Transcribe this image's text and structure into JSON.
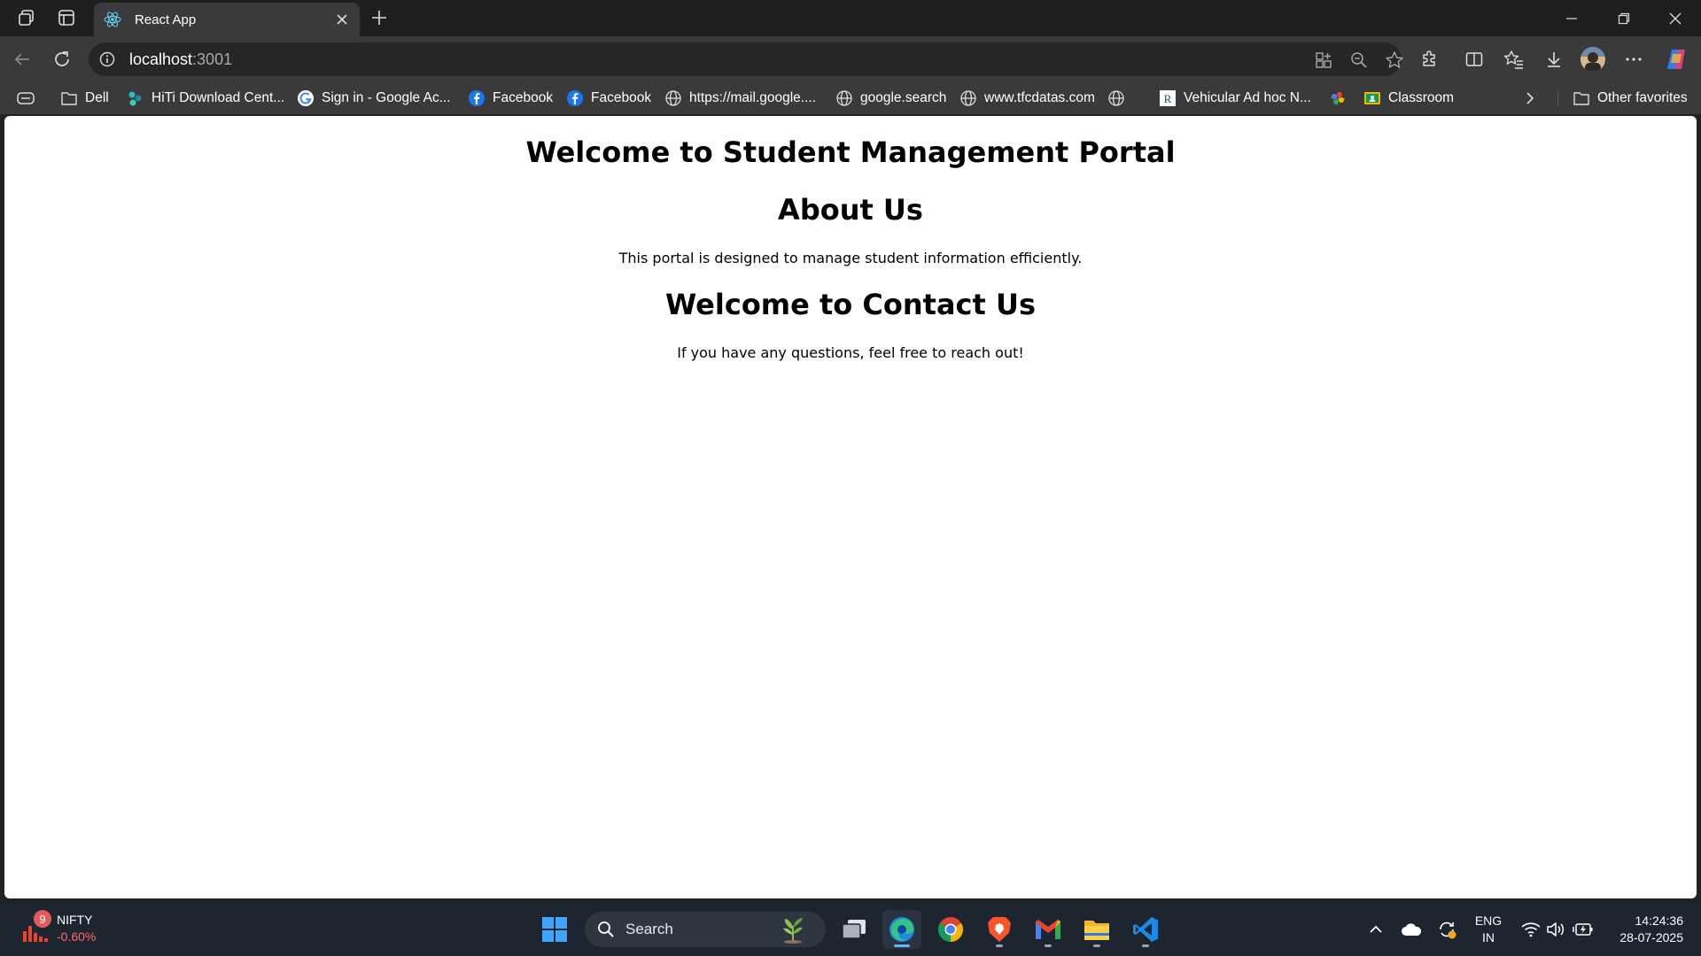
{
  "tab": {
    "title": "React App"
  },
  "omnibox": {
    "host": "localhost",
    "port": ":3001"
  },
  "bookmarks": {
    "items": [
      {
        "label": "Dell",
        "icon": "folder-icon"
      },
      {
        "label": "HiTi Download Cent...",
        "icon": "hiti-icon"
      },
      {
        "label": "Sign in - Google Ac...",
        "icon": "google-icon"
      },
      {
        "label": "Facebook",
        "icon": "facebook-icon"
      },
      {
        "label": "Facebook",
        "icon": "facebook-icon"
      },
      {
        "label": "https://mail.google....",
        "icon": "globe-icon"
      },
      {
        "label": "google.search",
        "icon": "globe-icon"
      },
      {
        "label": "www.tfcdatas.com",
        "icon": "globe-icon"
      },
      {
        "label": "",
        "icon": "globe-icon"
      },
      {
        "label": "Vehicular Ad hoc N...",
        "icon": "researchgate-icon"
      },
      {
        "label": "",
        "icon": "pinwheel-icon"
      },
      {
        "label": "Classroom",
        "icon": "classroom-icon"
      }
    ],
    "other": "Other favorites"
  },
  "page": {
    "heading1": "Welcome to Student Management Portal",
    "heading2": "About Us",
    "about_text": "This portal is designed to manage student information efficiently.",
    "heading3": "Welcome to Contact Us",
    "contact_text": "If you have any questions, feel free to reach out!"
  },
  "taskbar": {
    "widget": {
      "name": "NIFTY",
      "change": "-0.60%",
      "badge": "9"
    },
    "search_label": "Search",
    "lang": {
      "line1": "ENG",
      "line2": "IN"
    },
    "clock": {
      "time": "14:24:36",
      "date": "28-07-2025"
    }
  },
  "colors": {
    "tabstrip": "#1f1f1f",
    "toolbar": "#3a3a3a",
    "taskbar": "#1c2530",
    "nifty_negative": "#ff6b6b",
    "react_blue": "#61dafb"
  }
}
